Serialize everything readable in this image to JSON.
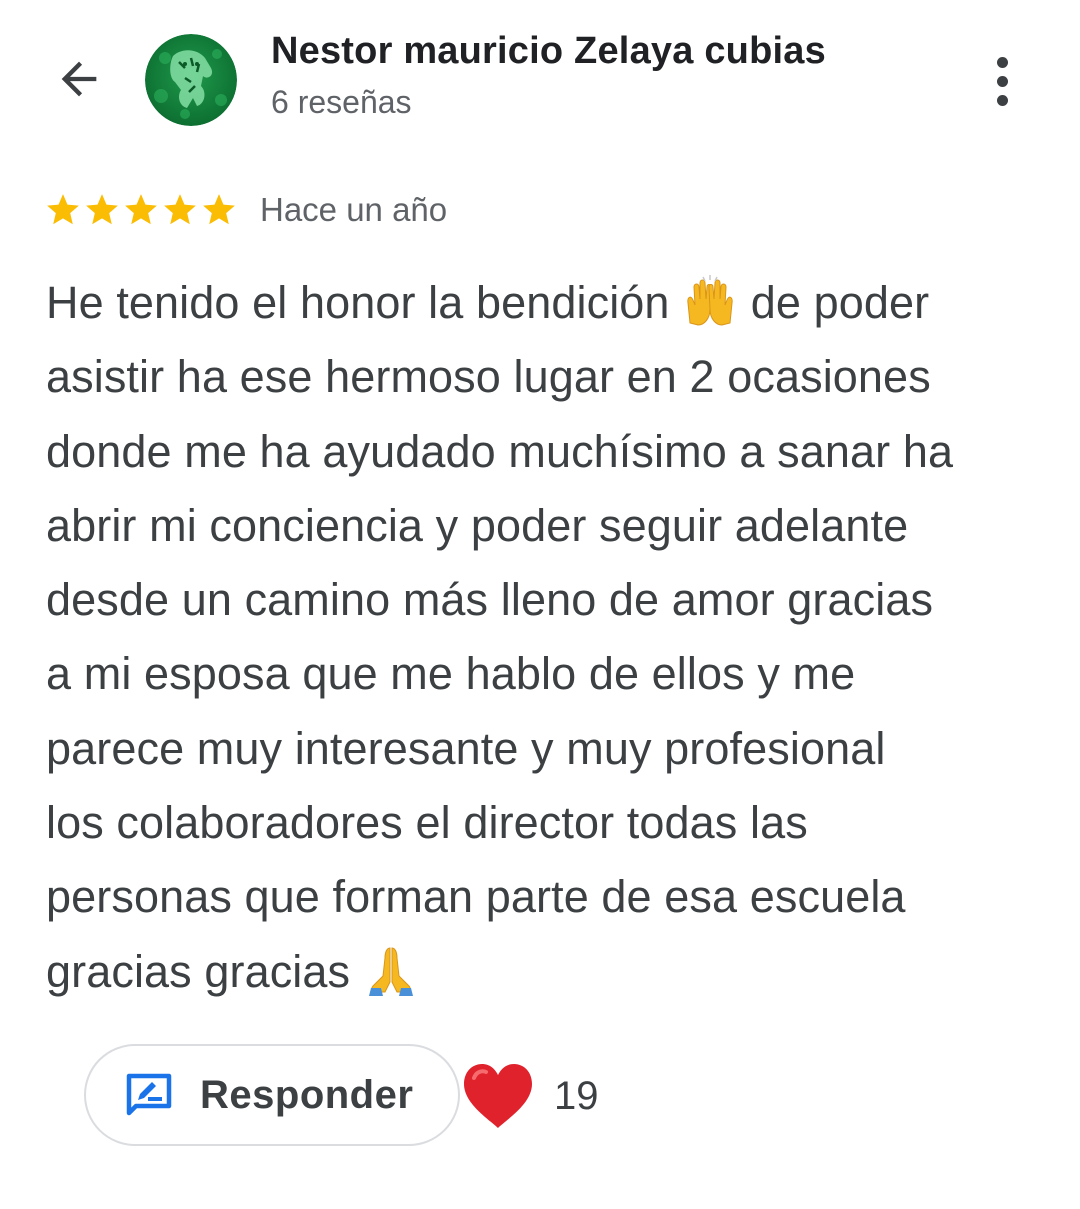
{
  "header": {
    "back_icon": "arrow-left-icon",
    "avatar_icon": "tiger-avatar",
    "reviewer_name": "Nestor mauricio Zelaya cubias",
    "review_count": "6 reseñas",
    "menu_icon": "more-vert-icon"
  },
  "review": {
    "rating": 5,
    "rating_max": 5,
    "star_color": "#fbbc04",
    "date": "Hace un año",
    "lines": [
      {
        "text": "He tenido el honor la bendición",
        "emoji": "raising-hands",
        "after": "de poder"
      },
      {
        "text": "asistir ha ese hermoso lugar en 2 ocasiones"
      },
      {
        "text": "donde me ha ayudado muchísimo a sanar ha"
      },
      {
        "text": "abrir mi conciencia y poder seguir adelante"
      },
      {
        "text": "desde un camino más lleno de amor gracias"
      },
      {
        "text": "a mi esposa que me hablo de ellos y me"
      },
      {
        "text": "parece muy interesante y muy profesional"
      },
      {
        "text": "los colaboradores el director todas las"
      },
      {
        "text": "personas que forman parte de esa escuela"
      },
      {
        "text": "gracias gracias",
        "emoji": "folded-hands"
      }
    ]
  },
  "actions": {
    "reply_label": "Responder",
    "reply_icon": "rate-review-icon",
    "reply_icon_color": "#1a73e8",
    "heart_icon": "red-heart",
    "heart_color": "#e0222d",
    "like_count": "19"
  }
}
